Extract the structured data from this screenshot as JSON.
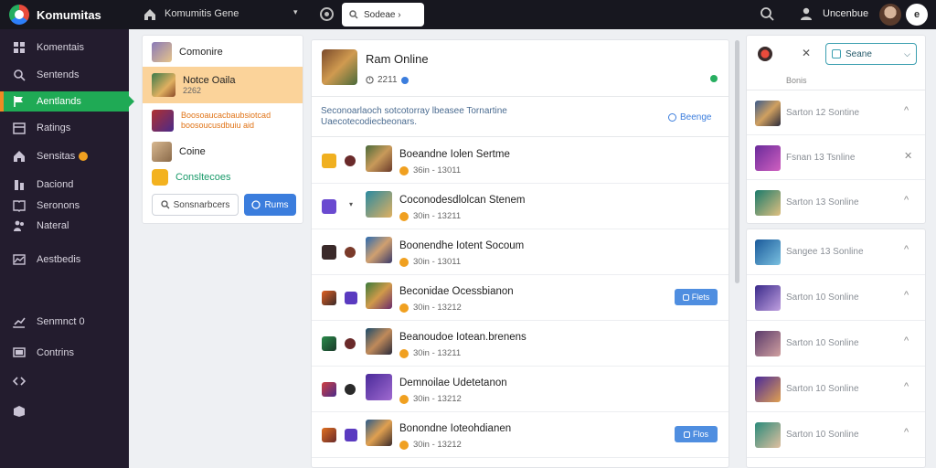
{
  "brand": {
    "name": "Komumitas"
  },
  "topbar": {
    "title": "Komumitis Gene",
    "caret": "▾",
    "select_label": "Sodeae ›",
    "user_name": "Uncenbue",
    "notif": "e"
  },
  "sidebar": {
    "items": [
      {
        "label": "Komentais",
        "icon": "grid-icon"
      },
      {
        "label": "Sentends",
        "icon": "search-icon"
      },
      {
        "label": "Aentlands",
        "icon": "flag-icon",
        "active": true
      },
      {
        "label": "Ratings",
        "icon": "calendar-icon"
      },
      {
        "label": "Sensitas",
        "icon": "home-icon"
      },
      {
        "label": "Daciond",
        "icon": "building-icon"
      },
      {
        "label": "Seronons",
        "icon": "book-icon"
      },
      {
        "label": "Nateral",
        "icon": "people-icon"
      },
      {
        "label": "Aestbedis",
        "icon": "chart-icon"
      },
      {
        "label": "Senmnct 0",
        "icon": "trend-icon"
      },
      {
        "label": "Contrins",
        "icon": "monitor-icon"
      },
      {
        "label": "",
        "icon": "code-icon"
      },
      {
        "label": "",
        "icon": "box-icon"
      }
    ]
  },
  "card1": {
    "items": [
      {
        "title": "Comonire"
      },
      {
        "title": "Notce Oaila",
        "sub": "2262"
      },
      {
        "title": "Boosoaucacbaubsiotcad boosoucusdbuiu aid"
      },
      {
        "title": "Coine"
      },
      {
        "title": "Consltecoes"
      }
    ],
    "outline_button": "Sonsnarbcers",
    "blue_button": "Rums"
  },
  "feed": {
    "header": {
      "title": "Ram Online",
      "meta": "2211"
    },
    "notice": {
      "text": "Seconoarlaoch sotcotorray lbeasee Tornartine Uaecotecodiecbeonars.",
      "link": "Beenge"
    },
    "rows": [
      {
        "title": "Boeandne Iolen Sertme",
        "meta": "36in - 13011"
      },
      {
        "title": "Coconodesdlolcan Stenem",
        "meta": "30in - 13211"
      },
      {
        "title": "Boonendhe Iotent Socoum",
        "meta": "30in - 13011"
      },
      {
        "title": "Beconidae Ocessbianon",
        "meta": "30in - 13212",
        "button": "Flets"
      },
      {
        "title": "Beanoudoe Iotean.brenens",
        "meta": "30in - 13211"
      },
      {
        "title": "Demnoilae Udetetanon",
        "meta": "30in - 13212"
      },
      {
        "title": "Bonondne Ioteohdianen",
        "meta": "30in - 13212",
        "button": "Flos"
      }
    ]
  },
  "right_panel": {
    "x_label": "✕",
    "select_label": "Seane",
    "select_chev": "⌵",
    "sub": "Bonis",
    "rows": [
      {
        "label": "Sarton 12 Sontine",
        "end": "^"
      },
      {
        "label": "Fsnan 13 Tsnline",
        "end": "✕"
      },
      {
        "label": "Sarton 13 Sonline",
        "end": "^"
      }
    ]
  },
  "right_panel2": {
    "rows": [
      {
        "label": "Sangee 13 Sonline",
        "end": "^"
      },
      {
        "label": "Sarton 10 Sonline",
        "end": "^"
      },
      {
        "label": "Sarton 10 Sonline",
        "end": "^"
      },
      {
        "label": "Sarton 10 Sonline",
        "end": "^"
      },
      {
        "label": "Sarton 10 Sonline",
        "end": "^"
      }
    ]
  }
}
